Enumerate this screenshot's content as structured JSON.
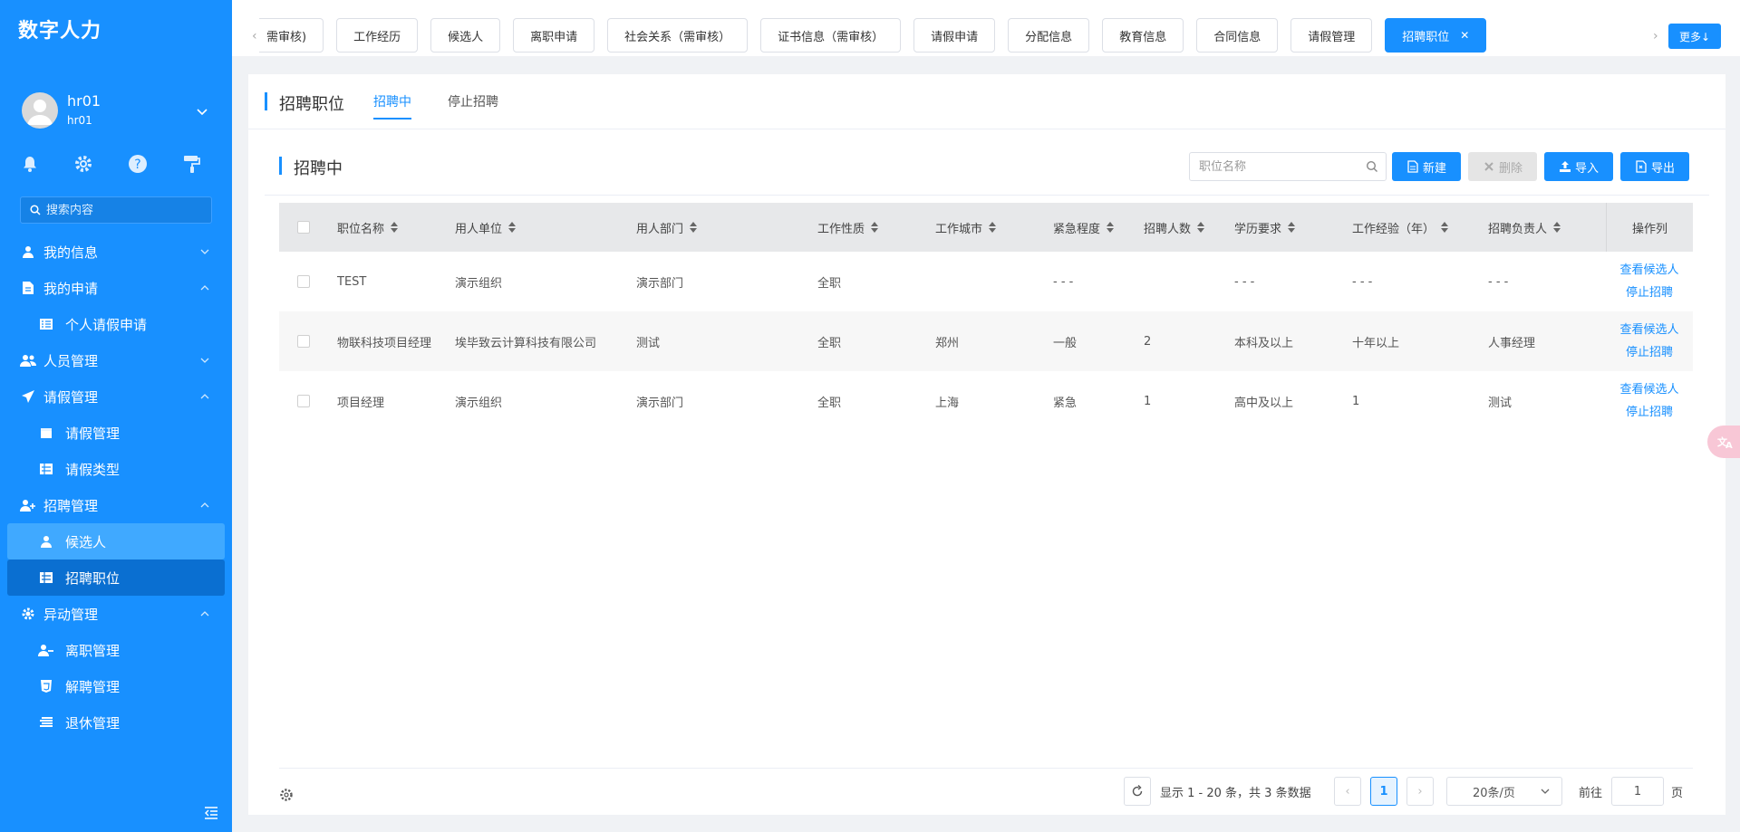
{
  "app": {
    "brand": "数字人力"
  },
  "user": {
    "name": "hr01",
    "id": "hr01"
  },
  "sidebar": {
    "search_placeholder": "搜索内容",
    "items": [
      {
        "label": "我的信息"
      },
      {
        "label": "我的申请"
      },
      {
        "label": "个人请假申请"
      },
      {
        "label": "人员管理"
      },
      {
        "label": "请假管理"
      },
      {
        "label": "请假管理"
      },
      {
        "label": "请假类型"
      },
      {
        "label": "招聘管理"
      },
      {
        "label": "候选人"
      },
      {
        "label": "招聘职位"
      },
      {
        "label": "异动管理"
      },
      {
        "label": "离职管理"
      },
      {
        "label": "解聘管理"
      },
      {
        "label": "退休管理"
      }
    ]
  },
  "tabs": {
    "items": [
      "需审核)",
      "工作经历",
      "候选人",
      "离职申请",
      "社会关系（需审核）",
      "证书信息（需审核）",
      "请假申请",
      "分配信息",
      "教育信息",
      "合同信息",
      "请假管理",
      "招聘职位"
    ],
    "more": "更多↓"
  },
  "page": {
    "title": "招聘职位",
    "subtabs": [
      "招聘中",
      "停止招聘"
    ],
    "section_title": "招聘中"
  },
  "toolbar": {
    "search_placeholder": "职位名称",
    "new": "新建",
    "delete": "删除",
    "import": "导入",
    "export": "导出"
  },
  "table": {
    "headers": [
      "职位名称",
      "用人单位",
      "用人部门",
      "工作性质",
      "工作城市",
      "紧急程度",
      "招聘人数",
      "学历要求",
      "工作经验（年）",
      "招聘负责人",
      "操作列"
    ],
    "rows": [
      {
        "name": "TEST",
        "unit": "演示组织",
        "dept": "演示部门",
        "nature": "全职",
        "city": "",
        "urgency": "- - -",
        "count": "",
        "edu": "- - -",
        "exp": "- - -",
        "owner": "- - -"
      },
      {
        "name": "物联科技项目经理",
        "unit": "埃毕致云计算科技有限公司",
        "dept": "测试",
        "nature": "全职",
        "city": "郑州",
        "urgency": "一般",
        "count": "2",
        "edu": "本科及以上",
        "exp": "十年以上",
        "owner": "人事经理"
      },
      {
        "name": "项目经理",
        "unit": "演示组织",
        "dept": "演示部门",
        "nature": "全职",
        "city": "上海",
        "urgency": "紧急",
        "count": "1",
        "edu": "高中及以上",
        "exp": "1",
        "owner": "测试"
      }
    ],
    "actions": [
      "查看候选人",
      "停止招聘"
    ]
  },
  "pagination": {
    "summary": "显示 1 - 20 条，共 3 条数据",
    "current_page": "1",
    "page_size": "20条/页",
    "goto_label": "前往",
    "goto_value": "1",
    "goto_suffix": "页"
  },
  "colors": {
    "primary": "#1890ff",
    "sidebar": "#1890ff",
    "active_dark": "#0a6fd1"
  }
}
